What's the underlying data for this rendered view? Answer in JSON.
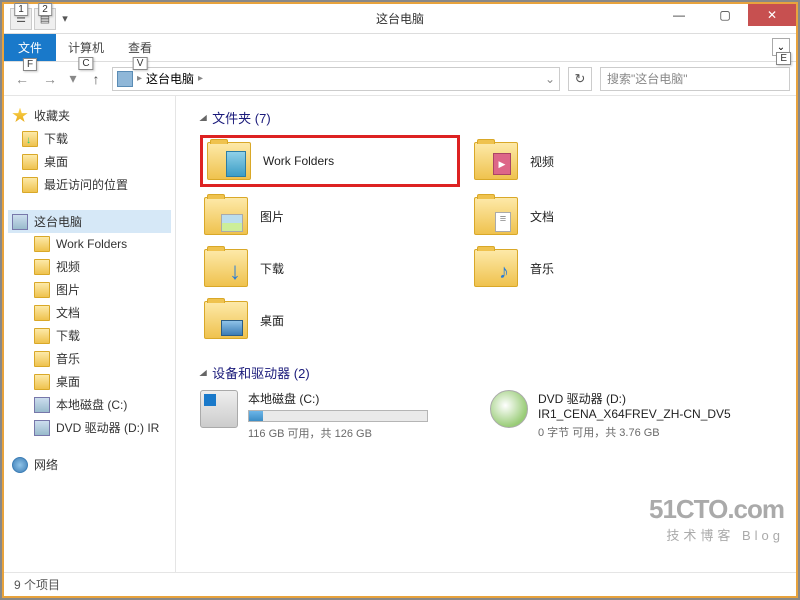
{
  "window": {
    "title": "这台电脑",
    "key_hints": {
      "qat1": "1",
      "qat2": "2",
      "file": "F",
      "computer": "C",
      "view": "V",
      "expand": "E"
    }
  },
  "ribbon": {
    "file": "文件",
    "tabs": [
      "计算机",
      "查看"
    ]
  },
  "nav": {
    "breadcrumb": "这台电脑",
    "search_placeholder": "搜索\"这台电脑\""
  },
  "tree": {
    "favorites": {
      "label": "收藏夹",
      "items": [
        "下载",
        "桌面",
        "最近访问的位置"
      ]
    },
    "pc": {
      "label": "这台电脑",
      "items": [
        "Work Folders",
        "视频",
        "图片",
        "文档",
        "下载",
        "音乐",
        "桌面",
        "本地磁盘 (C:)",
        "DVD 驱动器 (D:) IR"
      ]
    },
    "network": {
      "label": "网络"
    }
  },
  "content": {
    "folders_header": "文件夹 (7)",
    "folders": [
      {
        "name": "Work Folders",
        "icon": "wf",
        "highlight": true
      },
      {
        "name": "视频",
        "icon": "vid"
      },
      {
        "name": "图片",
        "icon": "pic"
      },
      {
        "name": "文档",
        "icon": "doc"
      },
      {
        "name": "下载",
        "icon": "dl2"
      },
      {
        "name": "音乐",
        "icon": "mus"
      },
      {
        "name": "桌面",
        "icon": "desk"
      }
    ],
    "drives_header": "设备和驱动器 (2)",
    "drives": [
      {
        "name": "本地磁盘 (C:)",
        "stats": "116 GB 可用，共 126 GB",
        "fill": 8,
        "type": "hdd"
      },
      {
        "name": "DVD 驱动器 (D:) IR1_CENA_X64FREV_ZH-CN_DV5",
        "stats": "0 字节 可用，共 3.76 GB",
        "fill": 0,
        "type": "dvd"
      }
    ]
  },
  "statusbar": {
    "text": "9 个项目"
  },
  "watermark": {
    "main": "51CTO.com",
    "sub": "技术博客 Blog"
  }
}
